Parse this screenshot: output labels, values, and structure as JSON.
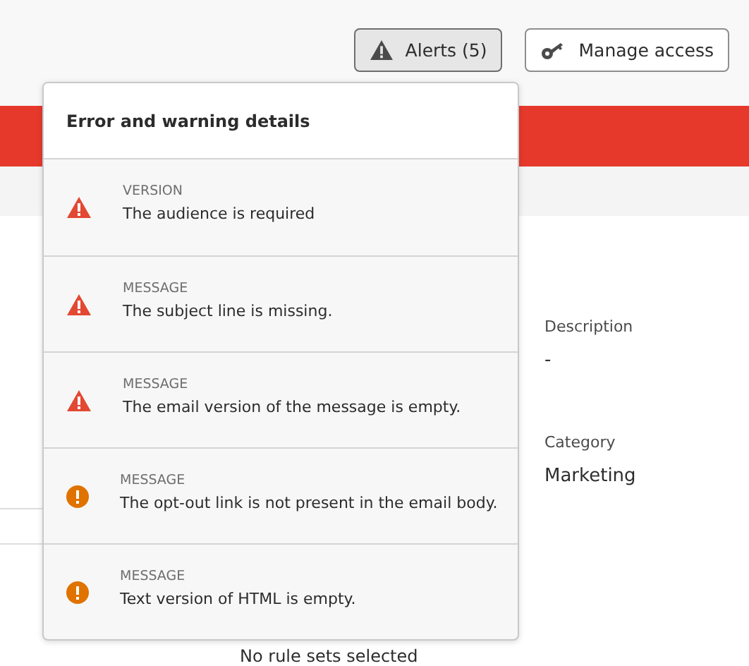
{
  "toolbar": {
    "alerts_button": {
      "label": "Alerts (5)",
      "selected": true
    },
    "manage_button": {
      "label": "Manage access"
    }
  },
  "details": [
    {
      "label": "Description",
      "value": "-"
    },
    {
      "label": "Category",
      "value": "Marketing"
    }
  ],
  "rule_sets_text": "No rule sets selected",
  "popover": {
    "title": "Error and warning details",
    "items": [
      {
        "kind": "error",
        "category": "VERSION",
        "message": "The audience is required"
      },
      {
        "kind": "error",
        "category": "MESSAGE",
        "message": "The subject line is missing."
      },
      {
        "kind": "error",
        "category": "MESSAGE",
        "message": "The email version of the message is empty."
      },
      {
        "kind": "warning",
        "category": "MESSAGE",
        "message": "The opt-out link is not present in the email body."
      },
      {
        "kind": "warning",
        "category": "MESSAGE",
        "message": "Text version of HTML is empty."
      }
    ]
  }
}
